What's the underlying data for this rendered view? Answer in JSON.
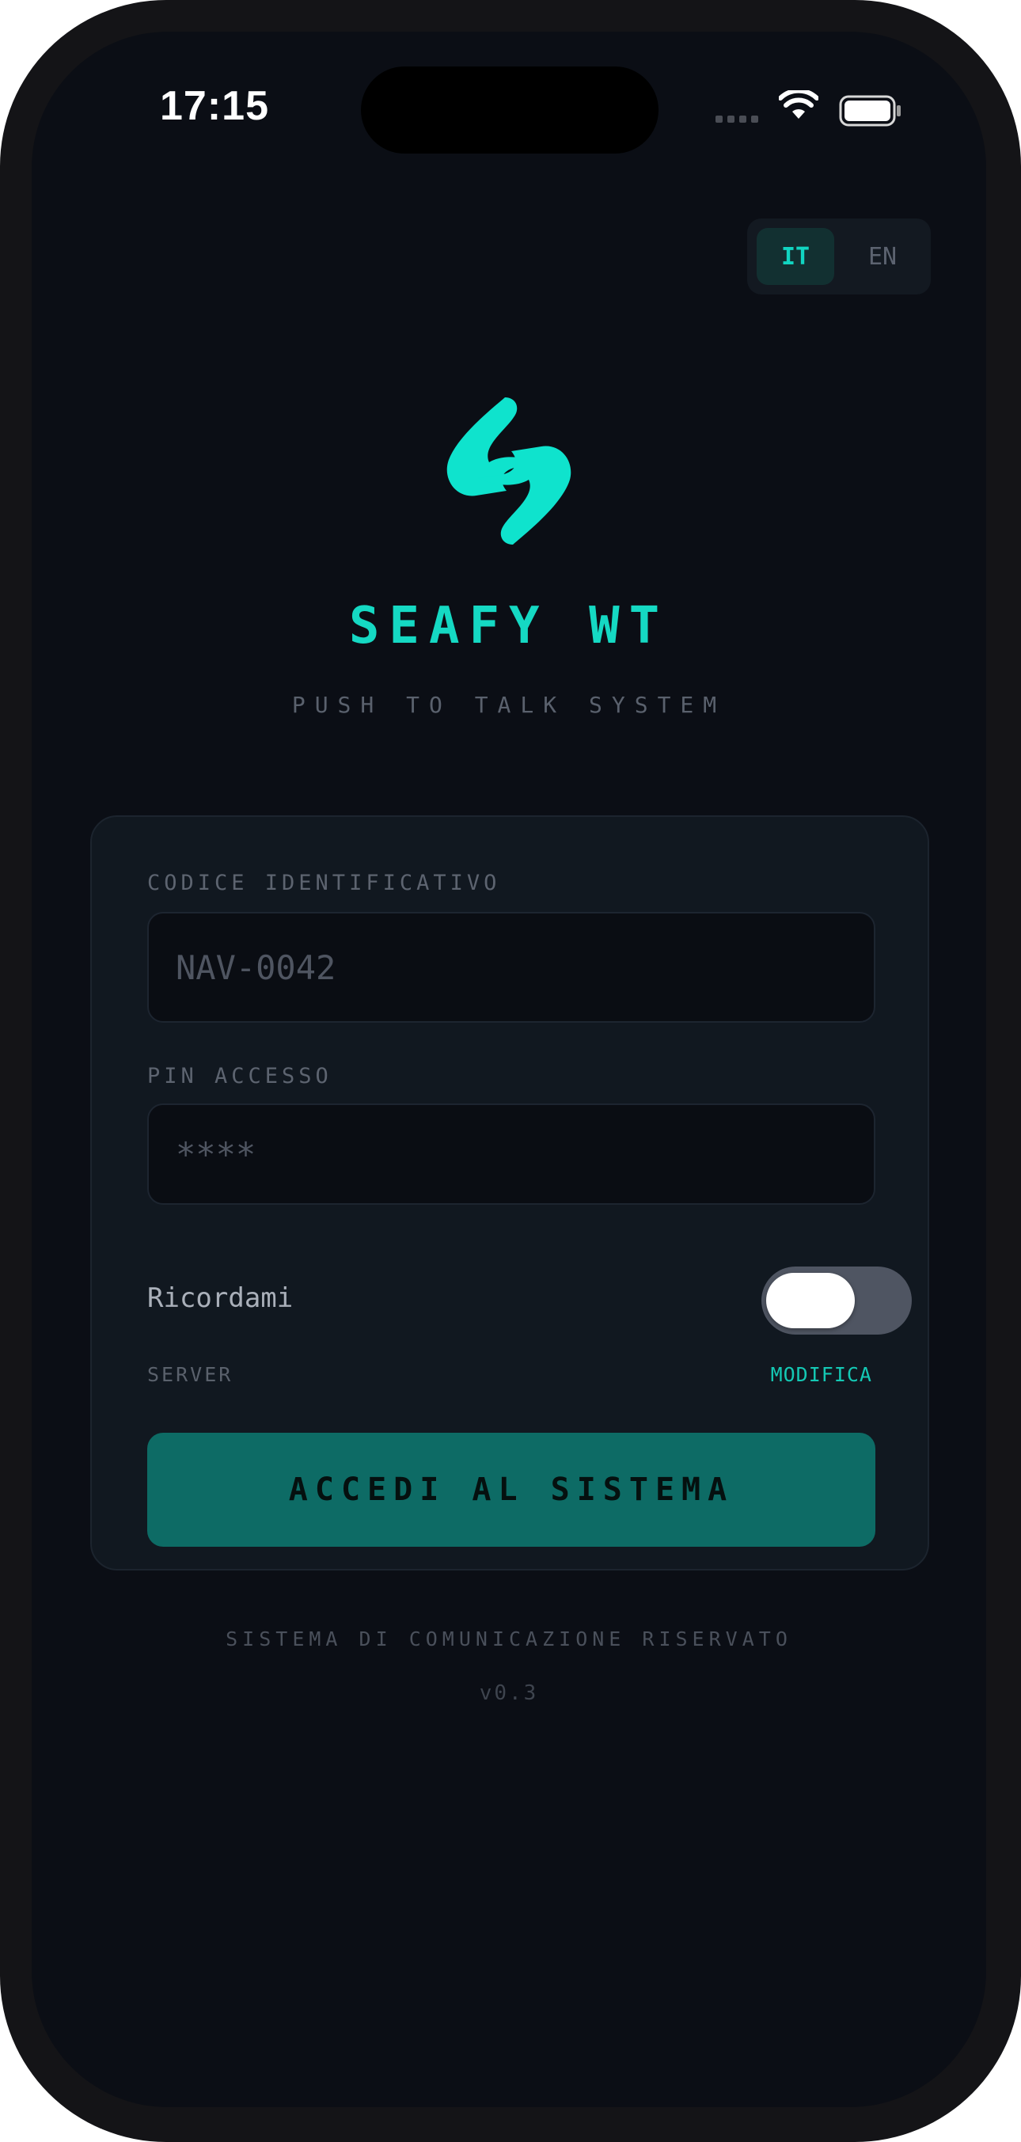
{
  "status_bar": {
    "time": "17:15"
  },
  "language": {
    "options": [
      "IT",
      "EN"
    ],
    "selected": "IT"
  },
  "app": {
    "title": "SEAFY WT",
    "subtitle": "PUSH TO TALK SYSTEM",
    "accent_color": "#15d9c3"
  },
  "form": {
    "code_label": "CODICE IDENTIFICATIVO",
    "code_placeholder": "NAV-0042",
    "code_value": "",
    "pin_label": "PIN ACCESSO",
    "pin_placeholder": "****",
    "pin_value": "",
    "remember_label": "Ricordami",
    "remember_on": false,
    "server_label": "SERVER",
    "server_edit_label": "MODIFICA",
    "submit_label": "ACCEDI AL SISTEMA",
    "submit_color": "#0d6b65"
  },
  "footer": {
    "note": "SISTEMA DI COMUNICAZIONE RISERVATO",
    "version": "v0.3"
  },
  "icons": [
    "signal-icon",
    "wifi-icon",
    "battery-icon",
    "app-logo-icon"
  ]
}
